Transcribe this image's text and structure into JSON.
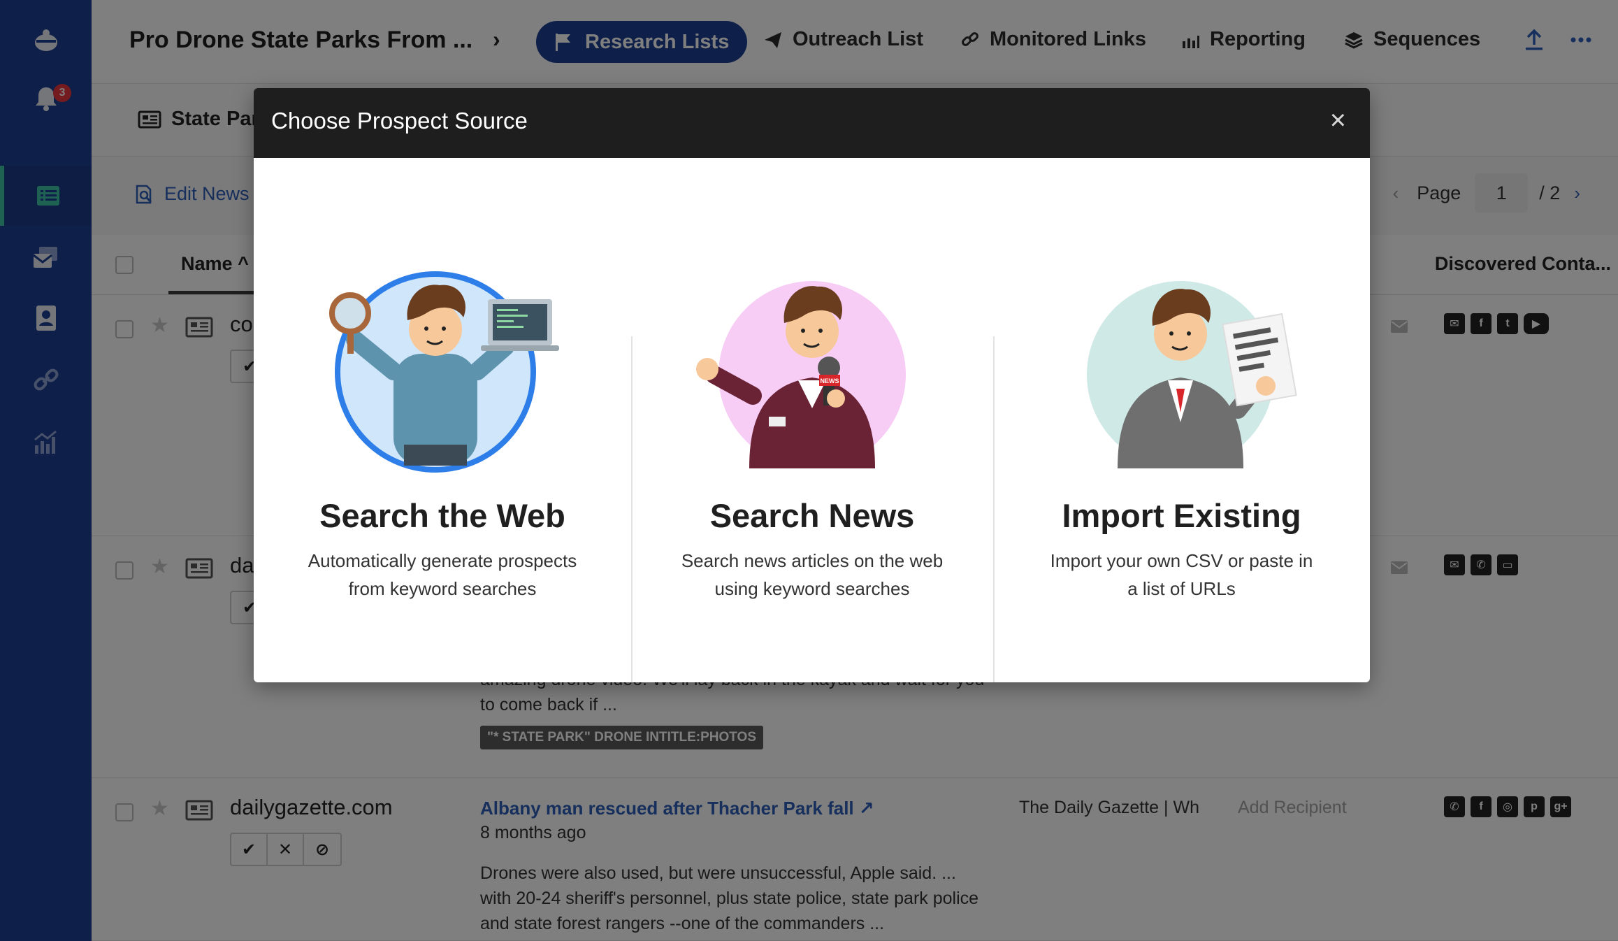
{
  "rail": {
    "notification_count": "3"
  },
  "topbar": {
    "project_title": "Pro Drone State Parks From ...",
    "chevron": "›",
    "nav": {
      "research_lists": "Research Lists",
      "outreach_list": "Outreach List",
      "monitored_links": "Monitored Links",
      "reporting": "Reporting",
      "sequences": "Sequences"
    }
  },
  "subbar": {
    "tab_label": "State Par"
  },
  "toolbar": {
    "edit_news": "Edit News",
    "page_label": "Page",
    "page_value": "1",
    "page_total": "/ 2"
  },
  "table": {
    "header_name": "Name",
    "header_contacts": "Discovered Conta..."
  },
  "rows": [
    {
      "domain": "co",
      "contacts": [
        "mail",
        "facebook",
        "twitter",
        "youtube"
      ]
    },
    {
      "domain": "da",
      "snippet_tail": "amazing drone video. We'll lay back in the kayak and wait for you to come back if ...",
      "tag": "\"* STATE PARK\" DRONE INTITLE:PHOTOS",
      "contacts": [
        "mail",
        "phone",
        "web"
      ]
    },
    {
      "domain": "dailygazette.com",
      "title": "Albany man rescued after Thacher Park fall",
      "age": "8 months ago",
      "snippet": "Drones were also used, but were unsuccessful, Apple said. ... with 20-24 sheriff's personnel, plus state police, state park police and state forest rangers --one of the commanders ...",
      "source": "The Daily Gazette | Wh",
      "add_recipient": "Add Recipient",
      "contacts": [
        "phone",
        "facebook",
        "instagram",
        "pinterest",
        "google-plus"
      ]
    }
  ],
  "modal": {
    "title": "Choose Prospect Source",
    "close": "×",
    "options": [
      {
        "title": "Search the Web",
        "desc_line1": "Automatically generate prospects",
        "desc_line2": "from keyword searches",
        "circle_color": "#cfe6fb",
        "ring_color": "#2d7ee8"
      },
      {
        "title": "Search News",
        "desc_line1": "Search news articles on the web",
        "desc_line2": "using keyword searches",
        "circle_color": "#f7cdf6",
        "illus_text": "NEWS"
      },
      {
        "title": "Import Existing",
        "desc_line1": "Import your own CSV or paste in",
        "desc_line2": "a list of URLs",
        "circle_color": "#cfe9e6"
      }
    ]
  },
  "colors": {
    "rail": "#1d3f93",
    "accent": "#3fc5a6",
    "link": "#2d5fb8",
    "badge": "#e7363f"
  }
}
